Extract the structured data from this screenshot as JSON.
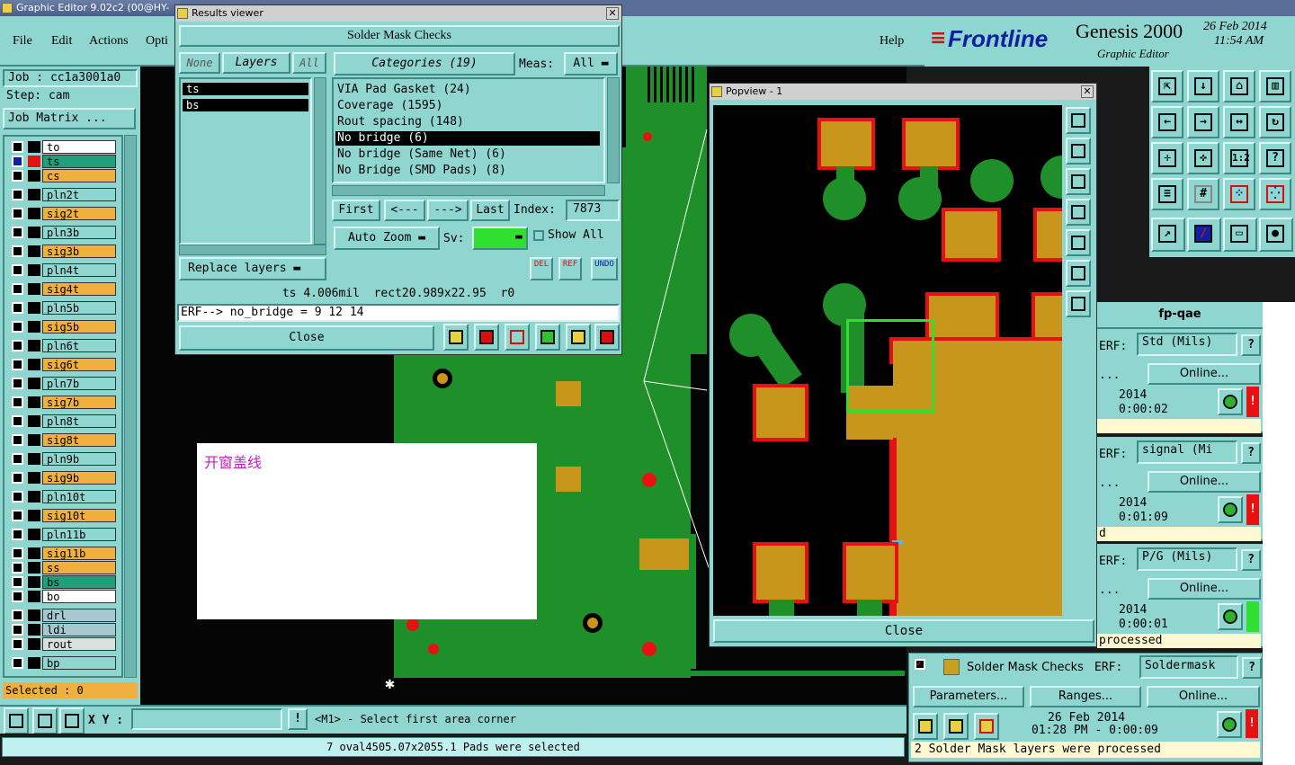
{
  "app": {
    "title": "Graphic Editor 9.02c2 (00@HY-",
    "menu": [
      "File",
      "Edit",
      "Actions",
      "Opti"
    ],
    "help": "Help",
    "brand": "Frontline",
    "product": "Genesis 2000",
    "subtitle": "Graphic Editor",
    "date": "26 Feb 2014",
    "time": "11:54 AM"
  },
  "sidebar": {
    "job": "Job : cc1a3001a0",
    "step": "Step: cam",
    "job_matrix": "Job Matrix ...",
    "selected": "Selected : 0",
    "layers": [
      {
        "name": "to",
        "color": "#ffffff"
      },
      {
        "name": "ts",
        "color": "#1f9f7a"
      },
      {
        "name": "cs",
        "color": "#f0b040"
      },
      {
        "name": "pln2t",
        "color": "#8fd6d0"
      },
      {
        "name": "sig2t",
        "color": "#f0b040"
      },
      {
        "name": "pln3b",
        "color": "#8fd6d0"
      },
      {
        "name": "sig3b",
        "color": "#f0b040"
      },
      {
        "name": "pln4t",
        "color": "#8fd6d0"
      },
      {
        "name": "sig4t",
        "color": "#f0b040"
      },
      {
        "name": "pln5b",
        "color": "#8fd6d0"
      },
      {
        "name": "sig5b",
        "color": "#f0b040"
      },
      {
        "name": "pln6t",
        "color": "#8fd6d0"
      },
      {
        "name": "sig6t",
        "color": "#f0b040"
      },
      {
        "name": "pln7b",
        "color": "#8fd6d0"
      },
      {
        "name": "sig7b",
        "color": "#f0b040"
      },
      {
        "name": "pln8t",
        "color": "#8fd6d0"
      },
      {
        "name": "sig8t",
        "color": "#f0b040"
      },
      {
        "name": "pln9b",
        "color": "#8fd6d0"
      },
      {
        "name": "sig9b",
        "color": "#f0b040"
      },
      {
        "name": "pln10t",
        "color": "#8fd6d0"
      },
      {
        "name": "sig10t",
        "color": "#f0b040"
      },
      {
        "name": "pln11b",
        "color": "#8fd6d0"
      },
      {
        "name": "sig11b",
        "color": "#f0b040"
      },
      {
        "name": "ss",
        "color": "#f0b040"
      },
      {
        "name": "bs",
        "color": "#1f9f7a"
      },
      {
        "name": "bo",
        "color": "#ffffff"
      },
      {
        "name": "drl",
        "color": "#a8c8d0"
      },
      {
        "name": "ldi",
        "color": "#a8c8d0"
      },
      {
        "name": "rout",
        "color": "#d8e0e0"
      },
      {
        "name": "bp",
        "color": "#8fd6d0"
      }
    ]
  },
  "results": {
    "title": "Results viewer",
    "heading": "Solder Mask Checks",
    "none": "None",
    "layers": "Layers",
    "all": "All",
    "layer_items": [
      "ts",
      "bs"
    ],
    "categories_label": "Categories (19)",
    "meas_label": "Meas:",
    "meas_value": "All",
    "categories": [
      "VIA Pad Gasket (24)",
      "Coverage (1595)",
      "Rout spacing (148)",
      "No bridge (6)",
      "No bridge (Same Net) (6)",
      "No Bridge (SMD Pads) (8)"
    ],
    "first": "First",
    "prev": "<---",
    "next": "--->",
    "last": "Last",
    "index_label": "Index:",
    "index_value": "7873",
    "auto_zoom": "Auto Zoom",
    "sv_label": "Sv:",
    "show_all": "Show All",
    "replace_layers": "Replace layers",
    "del": "DEL",
    "ref": "REF",
    "undo": "UNDO",
    "info": "ts 4.006mil  rect20.989x22.95  r0",
    "erf": "ERF--> no_bridge = 9 12 14",
    "close": "Close"
  },
  "popview": {
    "title": "Popview - 1",
    "close": "Close"
  },
  "note": {
    "text": "开窗盖线"
  },
  "right_panel": {
    "header": "fp-qae",
    "erf_label": "ERF:",
    "online": "Online...",
    "year": "2014",
    "rows": [
      {
        "erf": "Std (Mils)",
        "time": "0:00:02",
        "status": ""
      },
      {
        "erf": "signal (Mi",
        "time": "0:01:09",
        "status": "d"
      },
      {
        "erf": "P/G (Mils)",
        "time": "0:00:01",
        "status": "processed"
      }
    ],
    "sm_title": "Solder Mask Checks",
    "sm_erf": "Soldermask",
    "parameters": "Parameters...",
    "ranges": "Ranges...",
    "sm_date": "26 Feb 2014",
    "sm_time": "01:28 PM - 0:00:09",
    "sm_status": "2 Solder Mask layers were processed"
  },
  "bottom": {
    "xy_label": "X Y :",
    "xy_value": "",
    "prompt": "<M1> - Select first area corner",
    "status": "7 oval4505.07x2055.1 Pads were selected"
  },
  "colors": {
    "panel": "#8fd6d0",
    "pcb_green": "#1f8f2a",
    "pad_gold": "#c8961a",
    "violation_red": "#e81010",
    "highlight_green": "#30e030"
  }
}
